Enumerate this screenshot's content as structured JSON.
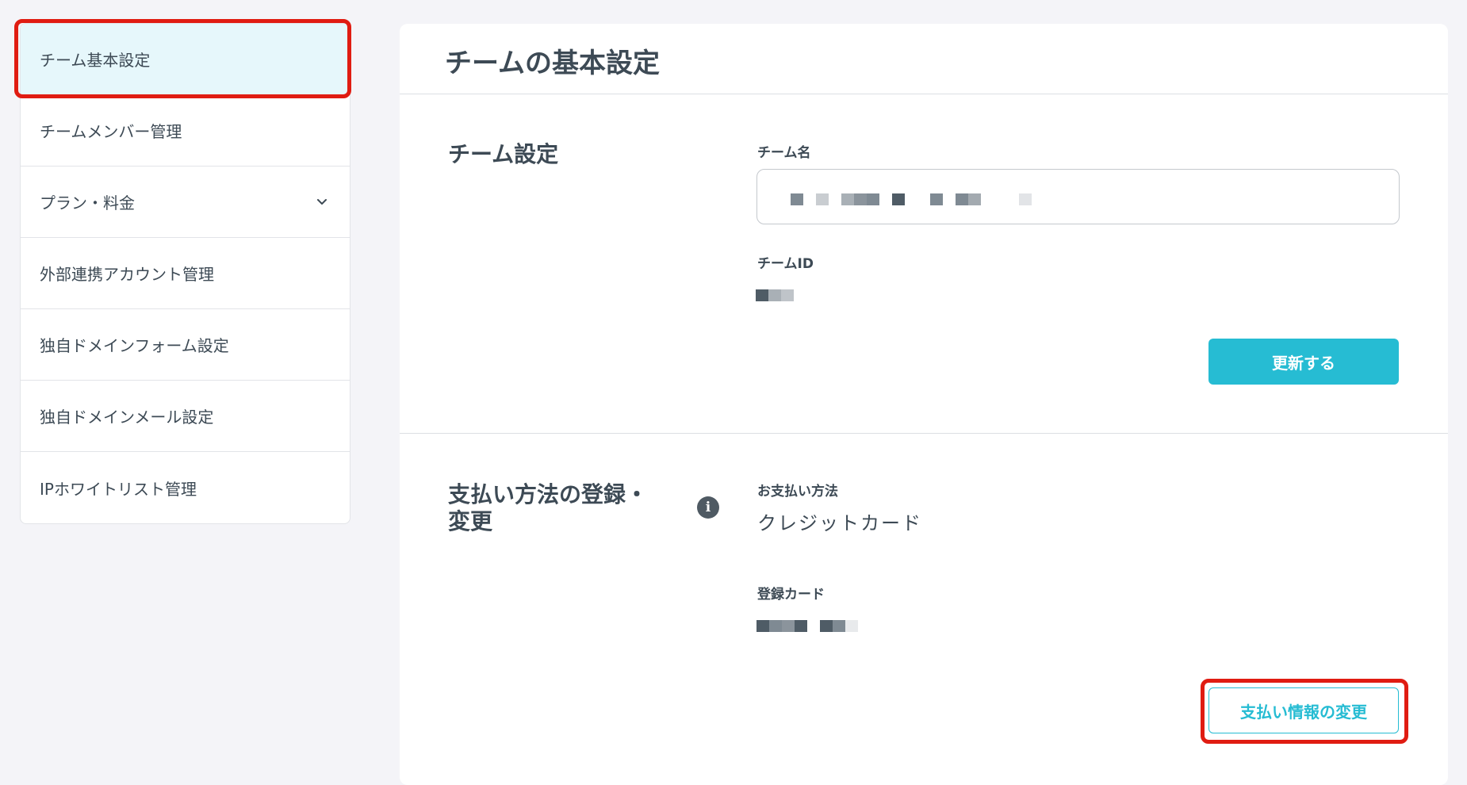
{
  "sidebar": {
    "items": [
      {
        "label": "チーム基本設定",
        "active": true
      },
      {
        "label": "チームメンバー管理"
      },
      {
        "label": "プラン・料金",
        "icon": "chevron-down-icon"
      },
      {
        "label": "外部連携アカウント管理"
      },
      {
        "label": "独自ドメインフォーム設定"
      },
      {
        "label": "独自ドメインメール設定"
      },
      {
        "label": "IPホワイトリスト管理"
      }
    ]
  },
  "main": {
    "title": "チームの基本設定",
    "team_settings": {
      "section_title": "チーム設定",
      "team_name_label": "チーム名",
      "team_id_label": "チームID",
      "update_button": "更新する"
    },
    "payment": {
      "section_title_line1": "支払い方法の登録・",
      "section_title_line2": "変更",
      "info_icon": "info-icon",
      "method_label": "お支払い方法",
      "method_value": "クレジットカード",
      "card_label": "登録カード",
      "change_button": "支払い情報の変更"
    }
  },
  "colors": {
    "accent": "#26bcd3",
    "active_bg": "#e6f7fb",
    "highlight": "#e01c12",
    "text": "#3d4a55"
  }
}
